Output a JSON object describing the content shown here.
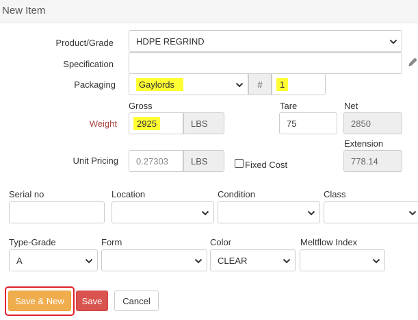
{
  "header": {
    "title": "New Item"
  },
  "form": {
    "product_grade": {
      "label": "Product/Grade",
      "value": "HDPE REGRIND"
    },
    "specification": {
      "label": "Specification",
      "value": ""
    },
    "packaging": {
      "label": "Packaging",
      "value": "Gaylords",
      "count_prefix": "#",
      "count": "1"
    },
    "weight": {
      "label": "Weight",
      "gross_label": "Gross",
      "gross": "2925",
      "unit": "LBS",
      "tare_label": "Tare",
      "tare": "75",
      "net_label": "Net",
      "net": "2850"
    },
    "unit_pricing": {
      "label": "Unit Pricing",
      "value": "0.27303",
      "unit": "LBS",
      "fixed_cost_label": "Fixed Cost",
      "extension_label": "Extension",
      "extension": "778.14"
    },
    "serial_no": {
      "label": "Serial no",
      "value": ""
    },
    "location": {
      "label": "Location",
      "value": ""
    },
    "condition": {
      "label": "Condition",
      "value": ""
    },
    "class": {
      "label": "Class",
      "value": ""
    },
    "type_grade": {
      "label": "Type-Grade",
      "value": "A"
    },
    "form_field": {
      "label": "Form",
      "value": ""
    },
    "color": {
      "label": "Color",
      "value": "CLEAR"
    },
    "meltflow_index": {
      "label": "Meltflow Index",
      "value": ""
    }
  },
  "buttons": {
    "save_new": "Save & New",
    "save": "Save",
    "cancel": "Cancel"
  },
  "icons": {
    "edit": "pencil-icon",
    "dropdown": "chevron-down-icon"
  },
  "colors": {
    "highlight": "#ffff33",
    "weight_label": "#a94442",
    "save_new": "#f0ad4e",
    "save": "#d9534f",
    "focus": "#e0202a"
  }
}
